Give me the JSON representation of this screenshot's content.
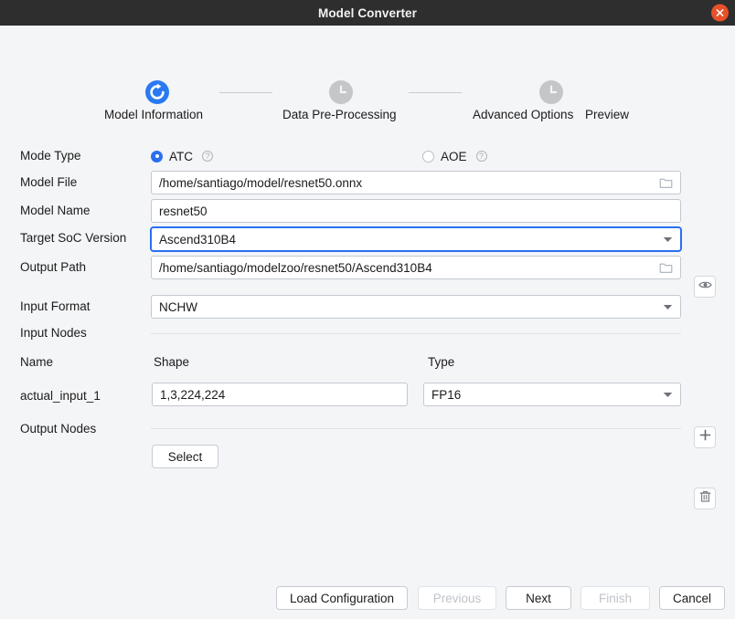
{
  "window": {
    "title": "Model Converter",
    "close_icon": "close-icon"
  },
  "stepper": {
    "steps": [
      {
        "label": "Model Information",
        "icon": "refresh-icon",
        "state": "active"
      },
      {
        "label": "Data Pre-Processing",
        "icon": "clock-icon",
        "state": "idle"
      },
      {
        "label": "Advanced Options",
        "icon": "clock-icon",
        "state": "idle"
      },
      {
        "label": "Preview",
        "icon": "clock-icon",
        "state": "idle"
      }
    ]
  },
  "form": {
    "mode_type": {
      "label": "Mode Type",
      "options": [
        {
          "label": "ATC",
          "selected": true,
          "help_icon": "help-icon"
        },
        {
          "label": "AOE",
          "selected": false,
          "help_icon": "help-icon"
        }
      ]
    },
    "model_file": {
      "label": "Model File",
      "value": "/home/santiago/model/resnet50.onnx",
      "browse_icon": "folder-icon",
      "view_icon": "eye-icon"
    },
    "model_name": {
      "label": "Model Name",
      "value": "resnet50"
    },
    "target_soc_version": {
      "label": "Target SoC Version",
      "value": "Ascend310B4",
      "focused": true,
      "caret_icon": "chevron-down-icon"
    },
    "output_path": {
      "label": "Output Path",
      "value": "/home/santiago/modelzoo/resnet50/Ascend310B4",
      "browse_icon": "folder-icon"
    },
    "input_format": {
      "label": "Input Format",
      "value": "NCHW",
      "caret_icon": "chevron-down-icon"
    },
    "input_nodes": {
      "label": "Input Nodes",
      "add_icon": "plus-icon",
      "columns": {
        "name": "Name",
        "shape": "Shape",
        "type": "Type"
      },
      "rows": [
        {
          "name": "actual_input_1",
          "shape": "1,3,224,224",
          "type": "FP16",
          "delete_icon": "trash-icon",
          "caret_icon": "chevron-down-icon"
        }
      ]
    },
    "output_nodes": {
      "label": "Output Nodes",
      "select_label": "Select"
    }
  },
  "footer": {
    "buttons": [
      {
        "label": "Load Configuration",
        "disabled": false
      },
      {
        "label": "Previous",
        "disabled": true
      },
      {
        "label": "Next",
        "disabled": false
      },
      {
        "label": "Finish",
        "disabled": true
      },
      {
        "label": "Cancel",
        "disabled": false
      }
    ]
  },
  "colors": {
    "titlebar_bg": "#2e2e2e",
    "page_bg": "#f4f5f7",
    "accent": "#2b6ff0",
    "close_bg": "#e8502a",
    "idle_step": "#c4c6c8"
  }
}
